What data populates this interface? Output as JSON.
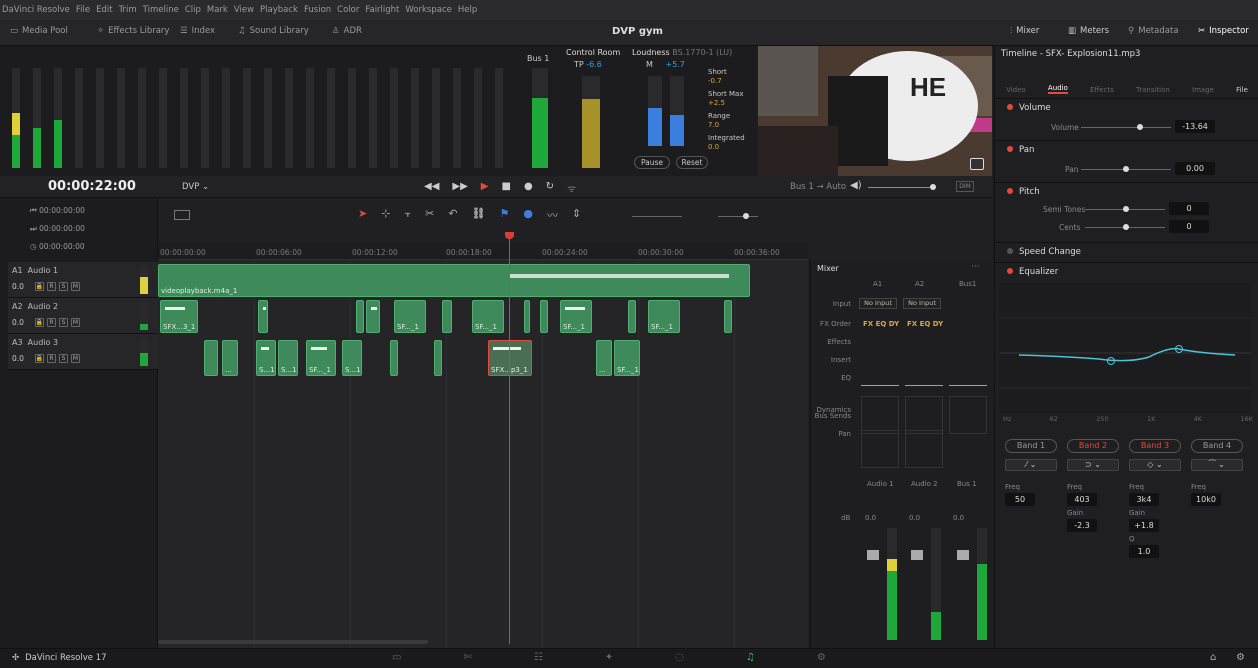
{
  "menu": [
    "DaVinci Resolve",
    "File",
    "Edit",
    "Trim",
    "Timeline",
    "Clip",
    "Mark",
    "View",
    "Playback",
    "Fusion",
    "Color",
    "Fairlight",
    "Workspace",
    "Help"
  ],
  "toolbar": {
    "media_pool": "Media Pool",
    "effects_library": "Effects Library",
    "index": "Index",
    "sound_library": "Sound Library",
    "adr": "ADR",
    "project_title": "DVP gym",
    "mixer": "Mixer",
    "meters": "Meters",
    "metadata": "Metadata",
    "inspector": "Inspector"
  },
  "meters": {
    "bus_label": "Bus 1"
  },
  "control_room": {
    "title": "Control Room",
    "tp_label": "TP",
    "tp_value": "-6.6",
    "m_label": "M",
    "m_value": "+5.7"
  },
  "loudness": {
    "title": "Loudness",
    "standard": "BS.1770-1 (LU)",
    "short_label": "Short",
    "short_value": "-0.7",
    "shortmax_label": "Short Max",
    "shortmax_value": "+2.5",
    "range_label": "Range",
    "range_value": "7.0",
    "integrated_label": "Integrated",
    "integrated_value": "0.0",
    "pause": "Pause",
    "reset": "Reset"
  },
  "transport": {
    "timecode": "00:00:22:00",
    "timeline_name": "DVP",
    "bus_route": "Bus 1 → Auto",
    "dim": "DIM"
  },
  "track_timecodes": [
    "00:00:00:00",
    "00:00:00:00",
    "00:00:00:00"
  ],
  "ruler": [
    "00:00:00:00",
    "00:00:06:00",
    "00:00:12:00",
    "00:00:18:00",
    "00:00:24:00",
    "00:00:30:00",
    "00:00:36:00"
  ],
  "tracks": [
    {
      "id": "A1",
      "name": "Audio 1",
      "vol": "0.0"
    },
    {
      "id": "A2",
      "name": "Audio 2",
      "vol": "0.0"
    },
    {
      "id": "A3",
      "name": "Audio 3",
      "vol": "0.0"
    }
  ],
  "clips": {
    "a1_main": "videoplayback.m4a_1",
    "a2_1": "SFX...3_1",
    "a2_2": "SF..._1",
    "a2_3": "SF..._1",
    "a2_4": "SF..._1",
    "a2_5": "SF..._1",
    "a3_1": "...",
    "a3_2": "S...1",
    "a3_3": "S...1",
    "a3_4": "SF..._1",
    "a3_5": "S...1",
    "a3_6": "SFX...p3_1",
    "a3_7": "...",
    "a3_8": "SF..._1"
  },
  "mixer": {
    "title": "Mixer",
    "cols": [
      "A1",
      "A2",
      "Bus1"
    ],
    "input_label": "Input",
    "input_vals": [
      "No Input",
      "No Input",
      ""
    ],
    "fxorder_label": "FX Order",
    "fx_val": "FX EQ DY",
    "effects_label": "Effects",
    "insert_label": "Insert",
    "eq_label": "EQ",
    "dynamics_label": "Dynamics",
    "bussends_label": "Bus Sends",
    "pan_label": "Pan",
    "strip_names": [
      "Audio 1",
      "Audio 2",
      "Bus 1"
    ],
    "db_label": "dB",
    "db_vals": [
      "0.0",
      "0.0",
      "0.0"
    ]
  },
  "inspector": {
    "clip_title": "Timeline - SFX- Explosion11.mp3",
    "tabs": [
      "Video",
      "Audio",
      "Effects",
      "Transition",
      "Image",
      "File"
    ],
    "volume_section": "Volume",
    "volume_label": "Volume",
    "volume_value": "-13.64",
    "pan_section": "Pan",
    "pan_label": "Pan",
    "pan_value": "0.00",
    "pitch_section": "Pitch",
    "semitones_label": "Semi Tones",
    "semitones_value": "0",
    "cents_label": "Cents",
    "cents_value": "0",
    "speed_section": "Speed Change",
    "eq_section": "Equalizer",
    "eq_xticks": [
      "Hz",
      "62",
      "250",
      "1K",
      "4K",
      "16K"
    ],
    "bands": [
      "Band 1",
      "Band 2",
      "Band 3",
      "Band 4"
    ],
    "freq_label": "Freq",
    "freq_vals": [
      "50",
      "403",
      "3k4",
      "10k0"
    ],
    "gain_label": "Gain",
    "gain_vals": [
      "-2.3",
      "+1.8"
    ],
    "q_label": "Q",
    "q_val": "1.0",
    "hz": "Hz",
    "db": "dB"
  },
  "bottom": {
    "app_name": "DaVinci Resolve 17"
  },
  "colors": {
    "accent": "#e24b3b",
    "clip_green": "#3e8a5a",
    "meter_green": "#1fa83a",
    "meter_yellow": "#e0d13a",
    "eq_curve": "#4cc3d9",
    "playhead": "#e03a3a"
  }
}
